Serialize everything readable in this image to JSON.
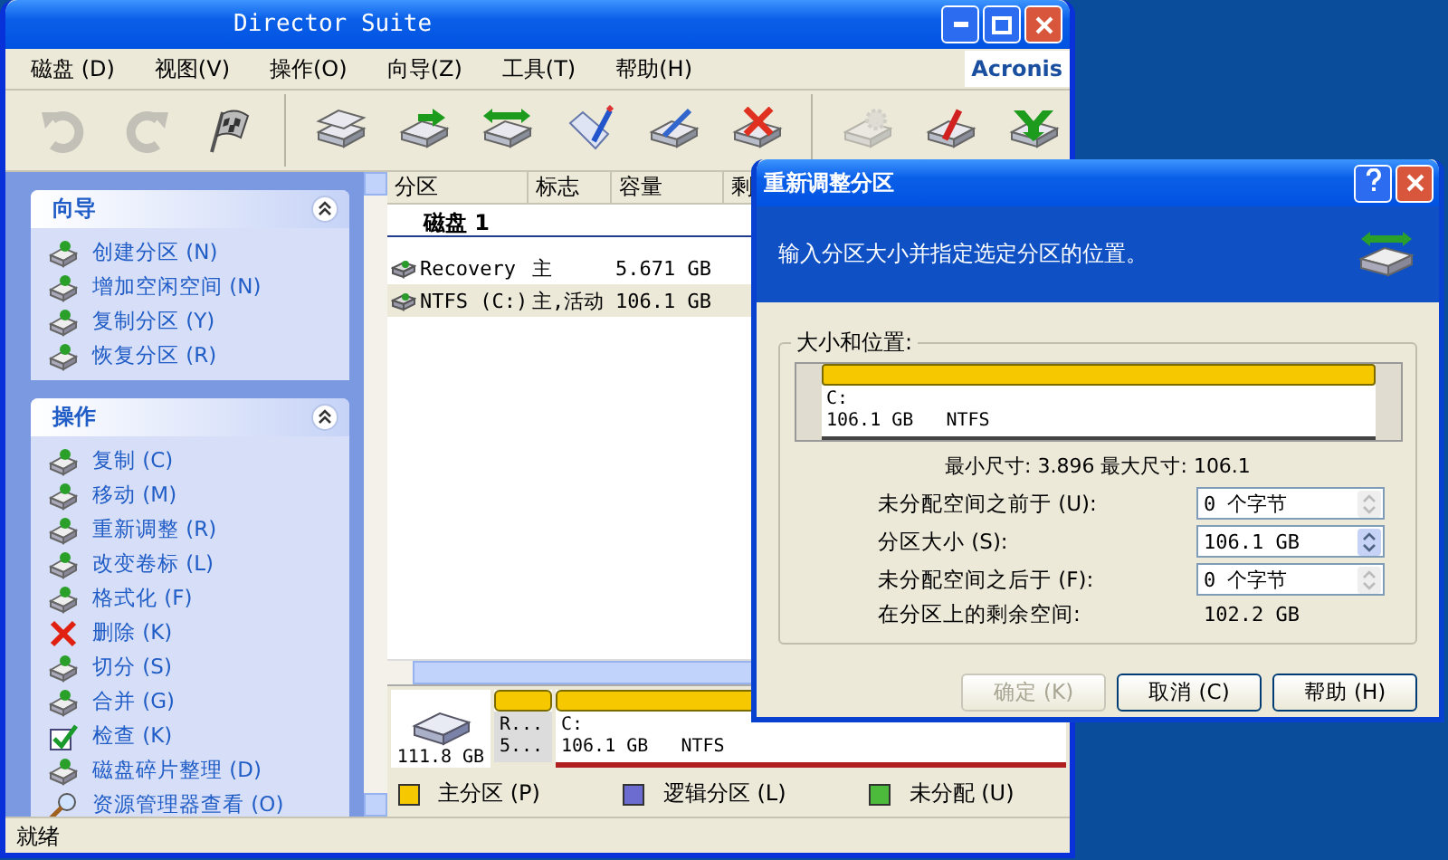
{
  "window": {
    "title": "Director Suite",
    "logo": "Acronis"
  },
  "menu": [
    "磁盘 (D)",
    "视图(V)",
    "操作(O)",
    "向导(Z)",
    "工具(T)",
    "帮助(H)"
  ],
  "toolbar": [
    {
      "kind": "undo",
      "disabled": true
    },
    {
      "kind": "redo",
      "disabled": true
    },
    {
      "kind": "flag",
      "disabled": false
    },
    {
      "kind": "sep"
    },
    {
      "kind": "copy",
      "disabled": false
    },
    {
      "kind": "move",
      "disabled": false
    },
    {
      "kind": "resize",
      "disabled": false
    },
    {
      "kind": "label",
      "disabled": false
    },
    {
      "kind": "format",
      "disabled": false
    },
    {
      "kind": "delete",
      "disabled": false
    },
    {
      "kind": "sep"
    },
    {
      "kind": "gear",
      "disabled": true
    },
    {
      "kind": "split",
      "disabled": false
    },
    {
      "kind": "merge",
      "disabled": false
    }
  ],
  "sidebar": [
    {
      "title": "向导",
      "expanded": true,
      "items": [
        {
          "label": "创建分区 (N)",
          "kind": "disk"
        },
        {
          "label": "增加空闲空间 (N)",
          "kind": "disk"
        },
        {
          "label": "复制分区 (Y)",
          "kind": "disk"
        },
        {
          "label": "恢复分区 (R)",
          "kind": "disk"
        }
      ]
    },
    {
      "title": "操作",
      "expanded": true,
      "items": [
        {
          "label": "复制 (C)",
          "kind": "disk"
        },
        {
          "label": "移动 (M)",
          "kind": "disk"
        },
        {
          "label": "重新调整 (R)",
          "kind": "disk"
        },
        {
          "label": "改变卷标 (L)",
          "kind": "disk"
        },
        {
          "label": "格式化 (F)",
          "kind": "disk"
        },
        {
          "label": "删除 (K)",
          "kind": "cross"
        },
        {
          "label": "切分 (S)",
          "kind": "disk"
        },
        {
          "label": "合并 (G)",
          "kind": "disk"
        },
        {
          "label": "检查 (K)",
          "kind": "check"
        },
        {
          "label": "磁盘碎片整理 (D)",
          "kind": "disk"
        },
        {
          "label": "资源管理器查看 (O)",
          "kind": "magnifier"
        }
      ]
    }
  ],
  "table": {
    "columns": [
      "分区",
      "标志",
      "容量",
      "剩"
    ],
    "group": "磁盘 1",
    "rows": [
      {
        "name": "Recovery",
        "flags": "主",
        "capacity": "5.671 GB",
        "selected": false
      },
      {
        "name": "NTFS (C:)",
        "flags": "主,活动",
        "capacity": "106.1 GB",
        "selected": true
      }
    ]
  },
  "disk_map": {
    "size": "111.8 GB",
    "partitions": [
      {
        "line1": "R...",
        "line2": "5...",
        "selected": false,
        "color": "#f5c800"
      },
      {
        "line1": "C:",
        "line2": "106.1 GB   NTFS",
        "selected": true,
        "color": "#f5c800"
      }
    ]
  },
  "legend": [
    {
      "label": "主分区 (P)",
      "color": "#f5c800"
    },
    {
      "label": "逻辑分区 (L)",
      "color": "#6b6bd0"
    },
    {
      "label": "未分配 (U)",
      "color": "#4cbb3c"
    }
  ],
  "status_bar": "就绪",
  "dialog": {
    "title": "重新调整分区",
    "header": "输入分区大小并指定选定分区的位置。",
    "group": "大小和位置:",
    "partition": {
      "line1": "C:",
      "line2": "106.1 GB   NTFS"
    },
    "limits": "最小尺寸: 3.896 最大尺寸: 106.1",
    "fields": [
      {
        "label": "未分配空间之前于 (U):",
        "value": "0 个字节",
        "kind": "spin",
        "disabled": true
      },
      {
        "label": "分区大小 (S):",
        "value": "106.1 GB",
        "kind": "spin",
        "disabled": false
      },
      {
        "label": "未分配空间之后于 (F):",
        "value": "0 个字节",
        "kind": "spin",
        "disabled": true
      },
      {
        "label": "在分区上的剩余空间:",
        "value": "102.2 GB",
        "kind": "text"
      }
    ],
    "buttons": [
      {
        "label": "确定 (K)",
        "disabled": true
      },
      {
        "label": "取消 (C)",
        "disabled": false
      },
      {
        "label": "帮助 (H)",
        "disabled": false
      }
    ]
  }
}
